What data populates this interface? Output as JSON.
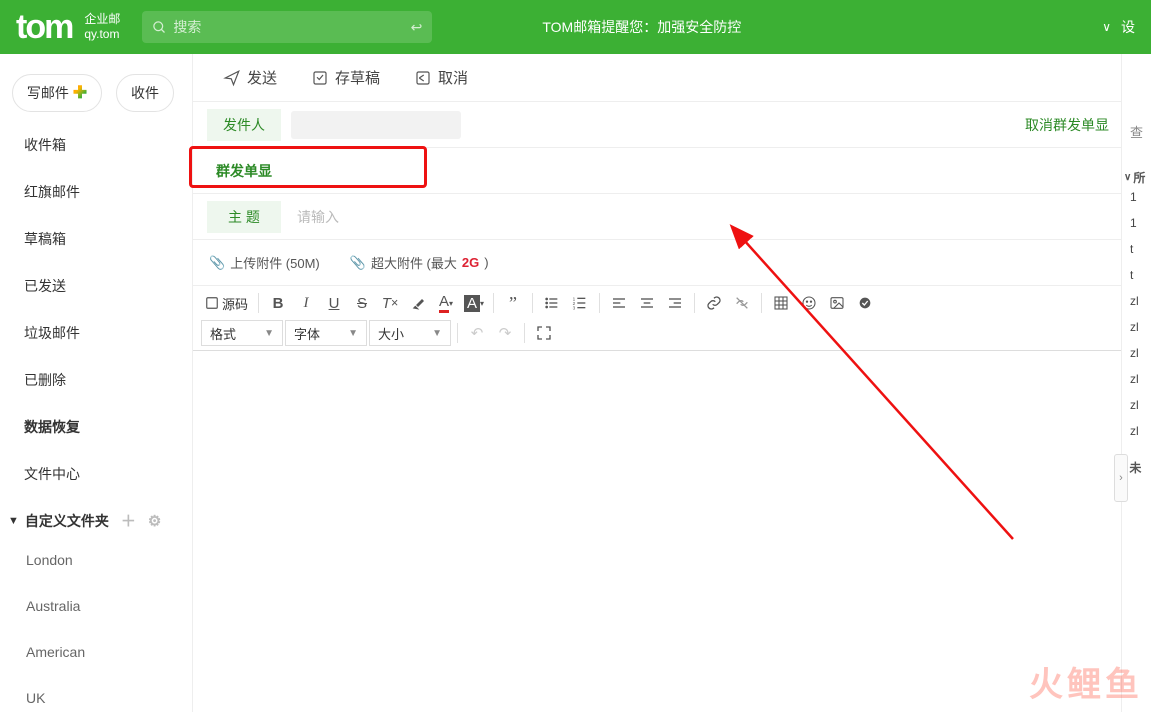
{
  "top": {
    "logo": "tom",
    "brand1": "企业邮",
    "brand2": "qy.tom",
    "search_ph": "搜索",
    "tip": "TOM邮箱提醒您：加强安全防控",
    "settings": "设"
  },
  "side": {
    "compose": "写邮件",
    "receive": "收件",
    "inbox": "收件箱",
    "flag": "红旗邮件",
    "draft": "草稿箱",
    "sent": "已发送",
    "trash": "垃圾邮件",
    "deleted": "已删除",
    "recover": "数据恢复",
    "files": "文件中心",
    "custom_hdr": "自定义文件夹",
    "f1": "London",
    "f2": "Australia",
    "f3": "American",
    "f4": "UK"
  },
  "actions": {
    "send": "发送",
    "draft": "存草稿",
    "cancel": "取消"
  },
  "row": {
    "sender_lab": "发件人",
    "cancel_group": "取消群发单显",
    "search_side": "查",
    "group_lab": "群发单显",
    "subject_lab": "主   题",
    "subject_ph": "请输入"
  },
  "attach": {
    "upload": "上传附件 (50M)",
    "big_pre": "超大附件 (最大 ",
    "big_sz": "2G",
    "big_post": ")"
  },
  "tb": {
    "source": "源码",
    "fmt": "格式",
    "font": "字体",
    "size": "大小"
  },
  "right": {
    "hdr": "所",
    "i1": "1",
    "i2": "1",
    "i3": "t",
    "i4": "t",
    "i5": "zl",
    "i6": "zl",
    "i7": "zl",
    "i8": "zl",
    "i9": "zl",
    "i10": "zl",
    "tail": "未"
  },
  "wm": "火鲤鱼"
}
